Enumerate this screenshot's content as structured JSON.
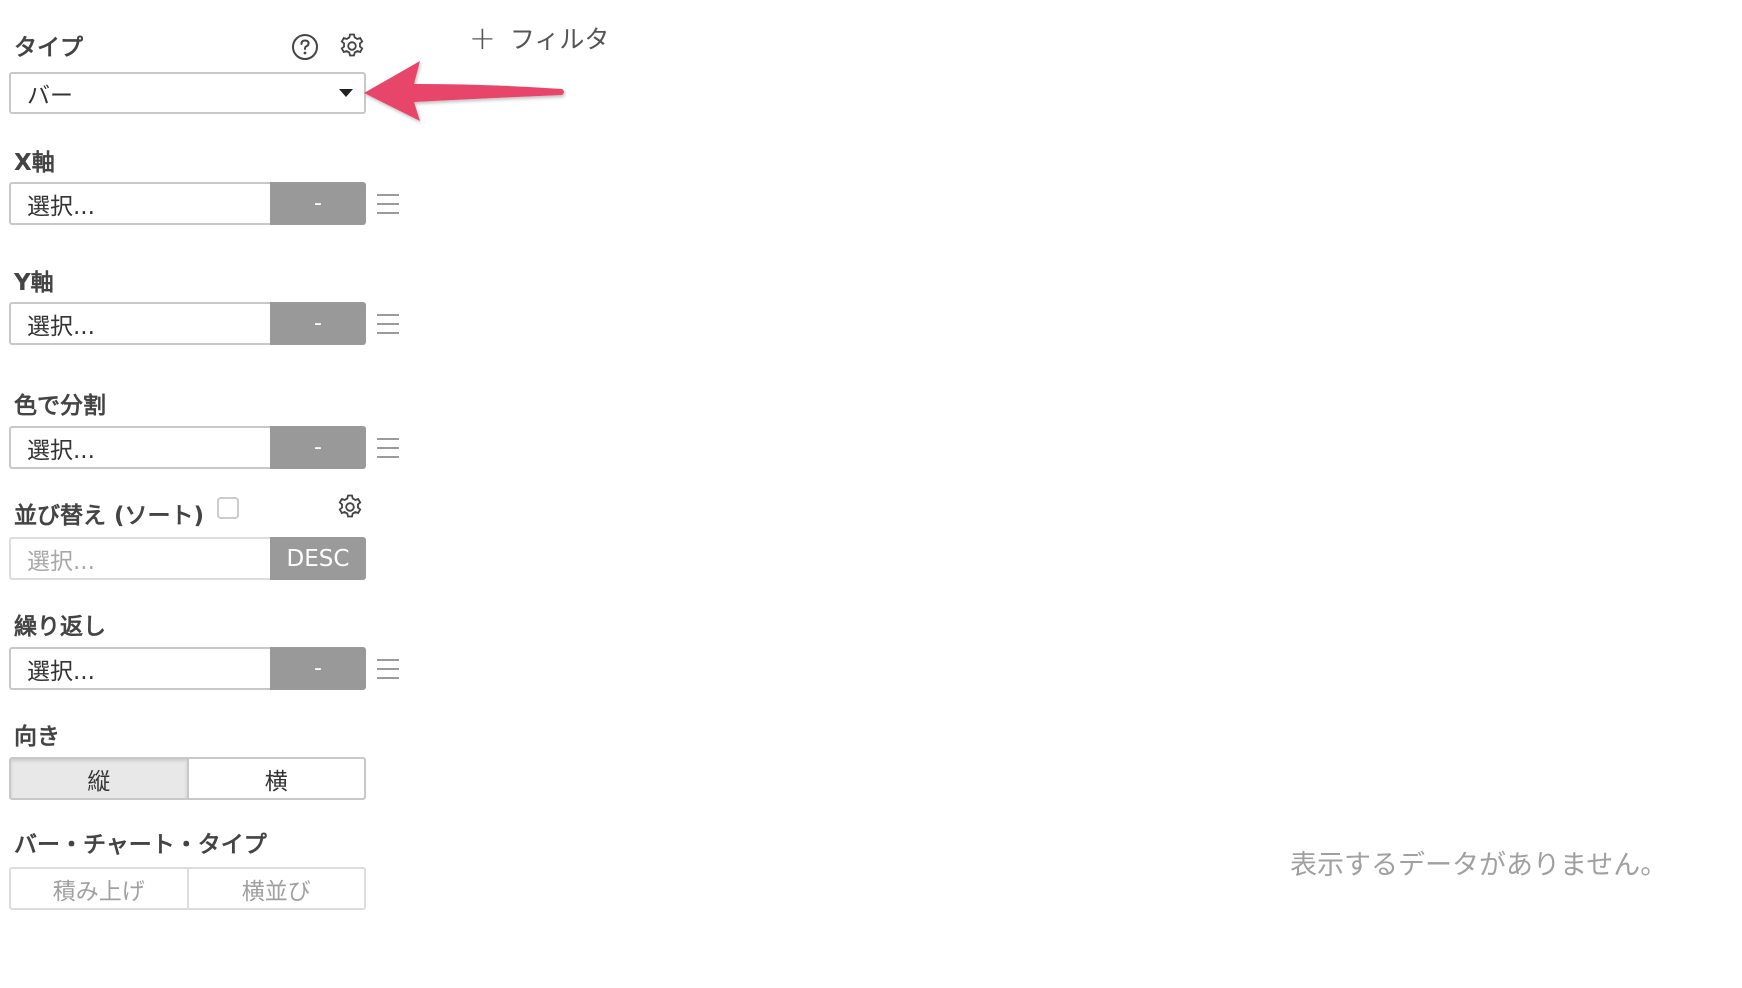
{
  "type_section": {
    "label": "タイプ",
    "help_icon": "question-circle-icon",
    "settings_icon": "gear-icon",
    "selected": "バー"
  },
  "x_axis": {
    "label": "X軸",
    "placeholder": "選択...",
    "button": "-"
  },
  "y_axis": {
    "label": "Y軸",
    "placeholder": "選択...",
    "button": "-"
  },
  "color_split": {
    "label": "色で分割",
    "placeholder": "選択...",
    "button": "-"
  },
  "sort": {
    "label": "並び替え (ソート)",
    "placeholder": "選択...",
    "button": "DESC",
    "settings_icon": "gear-icon"
  },
  "repeat": {
    "label": "繰り返し",
    "placeholder": "選択...",
    "button": "-"
  },
  "orientation": {
    "label": "向き",
    "options": [
      "縦",
      "横"
    ],
    "selected": "縦"
  },
  "bar_chart_type": {
    "label": "バー・チャート・タイプ",
    "options": [
      "積み上げ",
      "横並び"
    ]
  },
  "filter": {
    "label": "フィルタ",
    "icon": "plus-icon"
  },
  "empty_state": {
    "message": "表示するデータがありません。"
  },
  "annotation": {
    "arrow_color": "#e8456b"
  }
}
